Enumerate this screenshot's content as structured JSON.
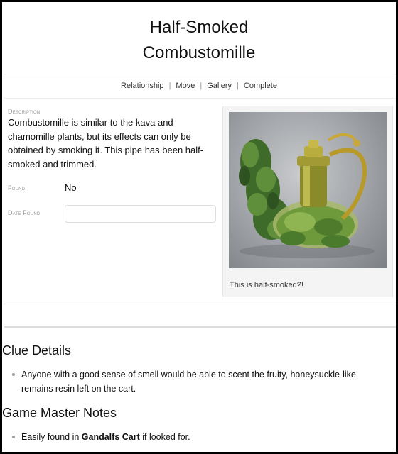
{
  "page": {
    "title_line1": "Half-Smoked",
    "title_line2": "Combustomille"
  },
  "nav": {
    "items": [
      {
        "label": "Relationship"
      },
      {
        "label": "Move"
      },
      {
        "label": "Gallery"
      },
      {
        "label": "Complete"
      }
    ],
    "separator": "|"
  },
  "details": {
    "description_label": "Description",
    "description_text": "Combustomille is similar to the kava and chamomille plants, but its effects can only be obtained by smoking it. This pipe has been half-smoked and trimmed.",
    "found_label": "Found",
    "found_value": "No",
    "date_found_label": "Date Found",
    "date_found_value": ""
  },
  "image_card": {
    "caption": "This is half-smoked?!"
  },
  "clue_details": {
    "heading": "Clue Details",
    "items": [
      {
        "text": "Anyone with a good sense of smell would be able to scent the fruity, honeysuckle-like remains resin left on the cart."
      }
    ]
  },
  "gm_notes": {
    "heading": "Game Master Notes",
    "item_prefix": "Easily found in ",
    "item_link": "Gandalfs Cart",
    "item_suffix": " if looked for."
  },
  "colors": {
    "border": "#000000",
    "label_gray": "#999999",
    "card_bg": "#f4f4f4"
  }
}
